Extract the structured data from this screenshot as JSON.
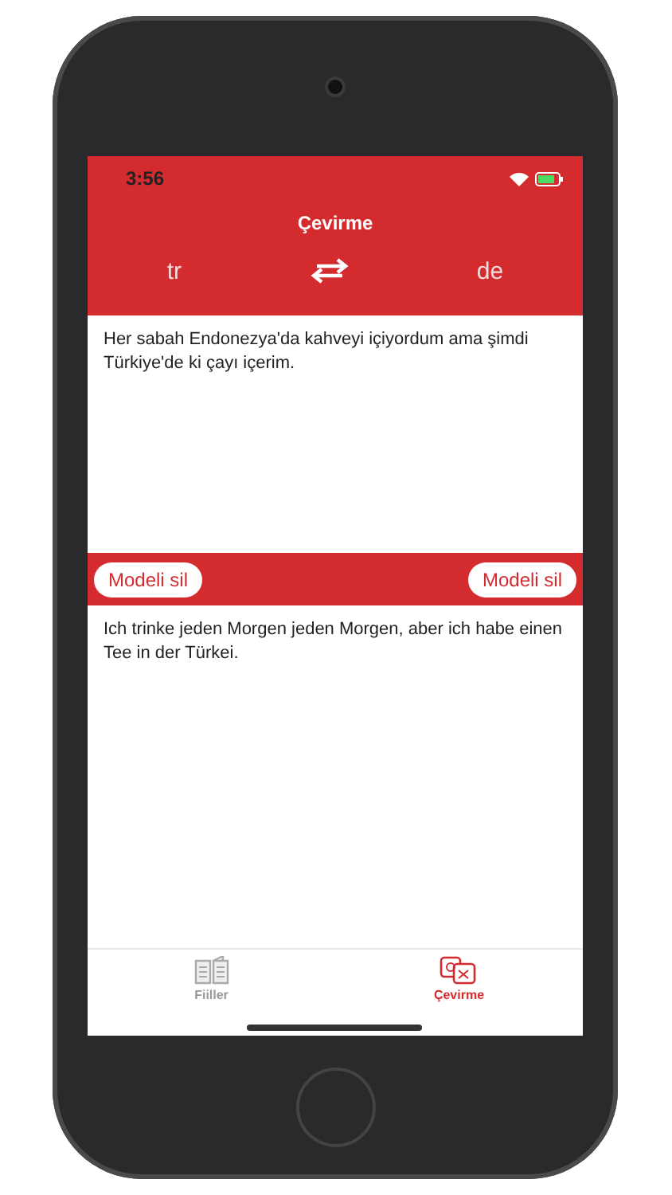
{
  "status_bar": {
    "time": "3:56"
  },
  "header": {
    "title": "Çevirme",
    "source_language": "tr",
    "target_language": "de"
  },
  "source_text": "Her sabah Endonezya'da kahveyi içiyordum ama şimdi Türkiye'de ki çayı içerim.",
  "model_bar": {
    "buttons": [
      "Modeli sil",
      "Modeli sil"
    ]
  },
  "translated_text": "Ich trinke jeden Morgen jeden Morgen, aber ich habe einen Tee in der Türkei.",
  "tab_bar": [
    {
      "label": "Fiiller",
      "kind": "book",
      "selected": false
    },
    {
      "label": "Çevirme",
      "kind": "translate",
      "selected": true
    }
  ]
}
